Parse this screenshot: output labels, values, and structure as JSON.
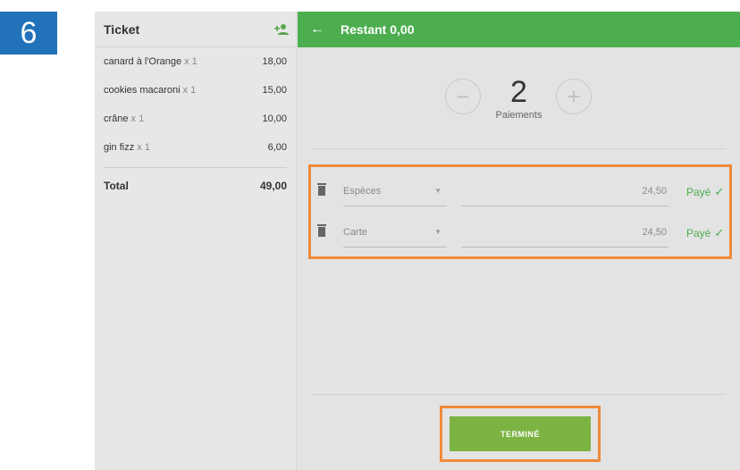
{
  "step_number": "6",
  "ticket": {
    "title": "Ticket",
    "add_person_icon": "add-person-icon",
    "items": [
      {
        "name": "canard à l'Orange",
        "qty": "x 1",
        "price": "18,00"
      },
      {
        "name": "cookies macaroni",
        "qty": "x 1",
        "price": "15,00"
      },
      {
        "name": "crâne",
        "qty": "x 1",
        "price": "10,00"
      },
      {
        "name": "gin fizz",
        "qty": "x 1",
        "price": "6,00"
      }
    ],
    "total_label": "Total",
    "total_value": "49,00"
  },
  "main": {
    "remaining": "Restant 0,00",
    "payment_count": "2",
    "payment_label": "Paiements",
    "minus_symbol": "−",
    "plus_symbol": "+",
    "payments": [
      {
        "method": "Espèces",
        "amount": "24,50",
        "status": "Payé"
      },
      {
        "method": "Carte",
        "amount": "24,50",
        "status": "Payé"
      }
    ],
    "done_label": "TERMINÉ"
  },
  "colors": {
    "topbar_green": "#4cae4f",
    "done_button_green": "#7cb342",
    "highlight_orange": "#ef8a3a",
    "step_badge_blue": "#2272b9"
  }
}
